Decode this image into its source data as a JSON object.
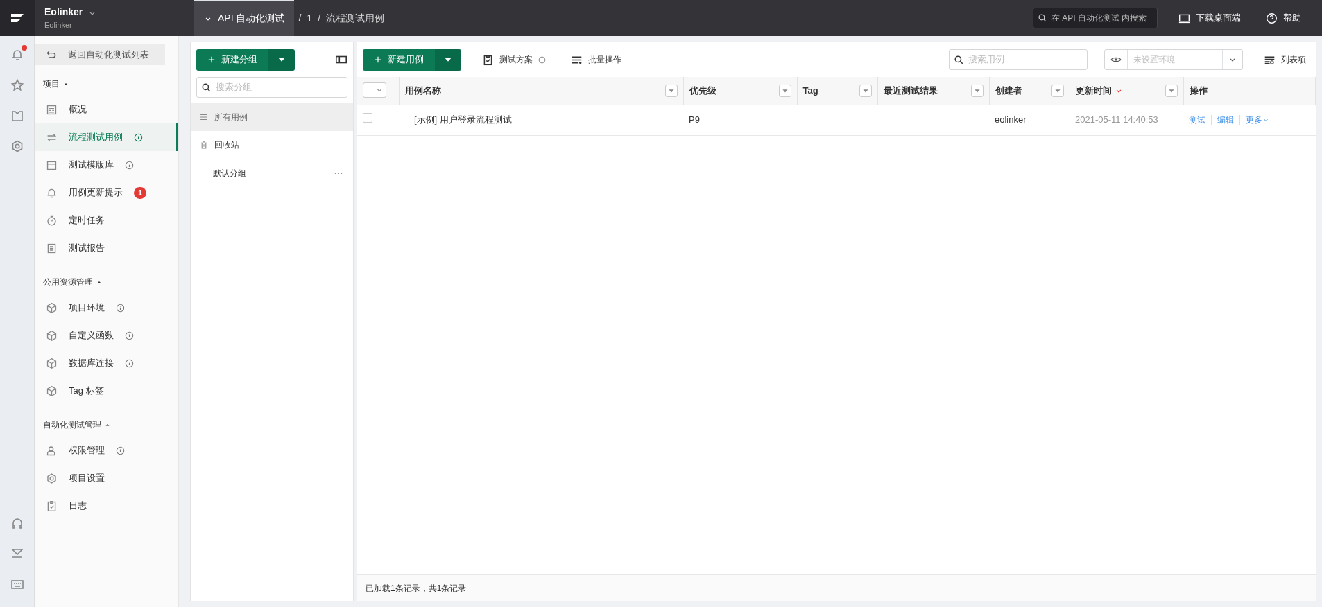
{
  "app": {
    "name": "Eolinker",
    "subtitle": "Eolinker"
  },
  "breadcrumb": {
    "project": "API 自动化测试",
    "separator": "/",
    "path": [
      "1",
      "流程测试用例"
    ]
  },
  "top_search": {
    "placeholder": "在 API 自动化测试 内搜索"
  },
  "top_actions": [
    {
      "kind": "monitor",
      "label": "下载桌面端"
    },
    {
      "kind": "help",
      "label": "帮助"
    }
  ],
  "rail": {
    "notification_dot": true
  },
  "sidebar": {
    "back_button": "返回自动化测试列表",
    "sections": [
      {
        "title": "项目",
        "expanded": true,
        "items": [
          {
            "kind": "overview",
            "label": "概况",
            "info": false,
            "selected": false
          },
          {
            "kind": "flow",
            "label": "流程测试用例",
            "info": true,
            "selected": true
          },
          {
            "kind": "template",
            "label": "测试模版库",
            "info": true,
            "selected": false
          },
          {
            "kind": "bell",
            "label": "用例更新提示",
            "info": false,
            "badge": "1",
            "selected": false
          },
          {
            "kind": "clock",
            "label": "定时任务",
            "info": false,
            "selected": false
          },
          {
            "kind": "report",
            "label": "测试报告",
            "info": false,
            "selected": false
          }
        ]
      },
      {
        "title": "公用资源管理",
        "expanded": true,
        "items": [
          {
            "kind": "cube",
            "label": "项目环境",
            "info": true,
            "selected": false
          },
          {
            "kind": "cube",
            "label": "自定义函数",
            "info": true,
            "selected": false
          },
          {
            "kind": "cube",
            "label": "数据库连接",
            "info": true,
            "selected": false
          },
          {
            "kind": "cube",
            "label": "Tag 标签",
            "info": false,
            "selected": false
          }
        ]
      },
      {
        "title": "自动化测试管理",
        "expanded": true,
        "items": [
          {
            "kind": "user",
            "label": "权限管理",
            "info": true,
            "selected": false
          },
          {
            "kind": "gear",
            "label": "项目设置",
            "info": false,
            "selected": false
          },
          {
            "kind": "clipboard",
            "label": "日志",
            "info": false,
            "selected": false
          }
        ]
      }
    ]
  },
  "groups": {
    "new_button": "新建分组",
    "search": {
      "placeholder": "搜索分组"
    },
    "items": [
      {
        "kind": "all",
        "label": "所有用例",
        "selected": true
      },
      {
        "kind": "trash",
        "label": "回收站",
        "selected": false
      },
      {
        "kind": "group",
        "label": "默认分组",
        "selected": false
      }
    ]
  },
  "toolbar": {
    "new_button": "新建用例",
    "actions": [
      {
        "kind": "plan",
        "label": "测试方案",
        "info": true
      },
      {
        "kind": "batch",
        "label": "批量操作",
        "info": false
      }
    ],
    "search": {
      "placeholder": "搜索用例"
    },
    "environment": {
      "placeholder": "未设置环境"
    },
    "columns_button": "列表项"
  },
  "table": {
    "select_all_checked": false,
    "columns": [
      {
        "label": "用例名称",
        "sorted": false
      },
      {
        "label": "优先级",
        "sorted": false
      },
      {
        "label": "Tag",
        "sorted": false
      },
      {
        "label": "最近测试结果",
        "sorted": false
      },
      {
        "label": "创建者",
        "sorted": false
      },
      {
        "label": "更新时间",
        "sorted": true
      },
      {
        "label": "操作",
        "sorted": false
      }
    ],
    "rows": [
      {
        "checked": false,
        "name": "[示例] 用户登录流程测试",
        "priority": "P9",
        "creator": "eolinker",
        "updated": "2021-05-11 14:40:53",
        "actions": [
          "测试",
          "编辑",
          "更多"
        ]
      }
    ]
  },
  "footer": "已加载1条记录，共1条记录"
}
